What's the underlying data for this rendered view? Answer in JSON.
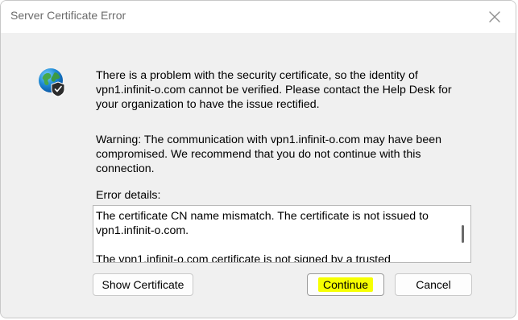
{
  "window": {
    "title": "Server Certificate Error",
    "close_icon": "close-icon"
  },
  "message": {
    "icon": "globe-shield-icon",
    "primary": "There is a problem with the security certificate, so the identity of vpn1.infinit-o.com cannot be verified. Please contact the Help Desk for your organization to have the issue rectified.",
    "warning": "Warning: The communication with vpn1.infinit-o.com may have been compromised. We recommend that you do not continue with this connection.",
    "details_label": "Error details:",
    "details_text": "The certificate CN name mismatch. The certificate is not issued to vpn1.infinit-o.com.\n\nThe vpn1.infinit-o.com certificate is not signed by a trusted"
  },
  "buttons": {
    "show_certificate": "Show Certificate",
    "continue": "Continue",
    "cancel": "Cancel"
  },
  "colors": {
    "highlight": "#f6ff00",
    "dialog_bg": "#f0f0f0"
  }
}
